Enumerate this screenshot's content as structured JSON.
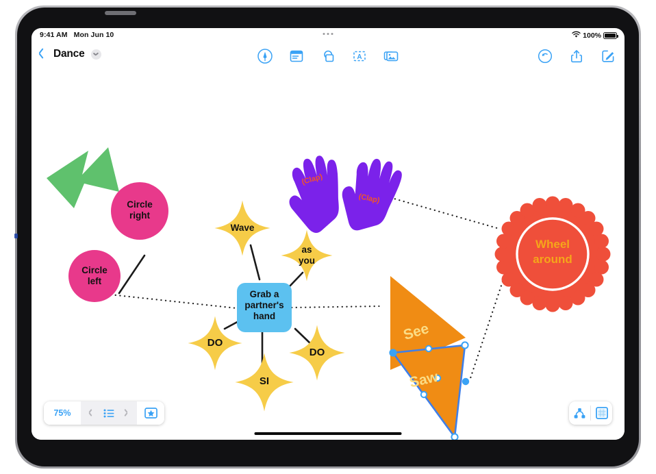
{
  "status_bar": {
    "time": "9:41 AM",
    "date": "Mon Jun 10",
    "wifi_icon": "wifi-icon",
    "battery_percent": "100%",
    "battery_icon": "battery-full-icon",
    "multitasking_icon": "multitasking-dots-icon"
  },
  "nav_bar": {
    "back_icon": "back-chevron-icon",
    "document_title": "Dance",
    "title_chevron_icon": "chevron-down-icon",
    "center_tools": [
      {
        "name": "draw-tool",
        "icon": "pen-circle-icon",
        "label": "Draw"
      },
      {
        "name": "sticky-note-tool",
        "icon": "sticky-note-icon",
        "label": "Sticky Note"
      },
      {
        "name": "shape-tool",
        "icon": "shapes-icon",
        "label": "Shapes"
      },
      {
        "name": "text-box-tool",
        "icon": "text-box-icon",
        "label": "Text Box"
      },
      {
        "name": "media-tool",
        "icon": "photos-icon",
        "label": "Media"
      }
    ],
    "right_tools": [
      {
        "name": "undo-button",
        "icon": "undo-arrow-icon",
        "label": "Undo"
      },
      {
        "name": "share-button",
        "icon": "share-up-arrow-icon",
        "label": "Share"
      },
      {
        "name": "compose-button",
        "icon": "compose-pencil-square-icon",
        "label": "Compose"
      }
    ]
  },
  "bottom_bar": {
    "zoom_level": "75%",
    "prev_icon": "chevron-left-icon",
    "page_list_icon": "list-bullet-icon",
    "next_icon": "chevron-right-icon",
    "star_icon": "star-in-rect-icon",
    "mindmap_icon": "node-graph-icon",
    "frame_icon": "frame-grid-icon"
  },
  "colors": {
    "accent_blue": "#3aa2f5",
    "pink": "#e8398b",
    "yellow_star": "#f6cc48",
    "node_blue": "#5cc1f0",
    "purple_hand": "#7b22ea",
    "clap_text": "#f2542a",
    "red_badge": "#ef4f3a",
    "wheel_text": "#f5a61a",
    "orange_triangle": "#f08c14",
    "triangle_text": "#fbdc85",
    "green_arrow": "#5cc濃"
  },
  "canvas": {
    "shapes": [
      {
        "id": "green-arrow",
        "name": "green-arrow-shape",
        "type": "arrow",
        "text": "",
        "fill": "#5fc16d"
      },
      {
        "id": "circle-right",
        "name": "circle-right-node",
        "type": "circle",
        "text": "Circle\nright",
        "fill": "#e8398b",
        "text_color": "#111111"
      },
      {
        "id": "circle-left",
        "name": "circle-left-node",
        "type": "circle",
        "text": "Circle\nleft",
        "fill": "#e8398b",
        "text_color": "#111111"
      },
      {
        "id": "hands",
        "name": "clapping-hands-shape",
        "type": "hands",
        "text": "(Clap)",
        "fill": "#7b22ea",
        "text_color": "#f2542a"
      },
      {
        "id": "star-wave",
        "name": "wave-star-node",
        "type": "four-point-star",
        "text": "Wave",
        "fill": "#f6cc48",
        "text_color": "#111111"
      },
      {
        "id": "star-asyou",
        "name": "as-you-star-node",
        "type": "four-point-star",
        "text": "as\nyou",
        "fill": "#f6cc48",
        "text_color": "#111111"
      },
      {
        "id": "center-node",
        "name": "grab-partner-node",
        "type": "rounded-rect",
        "text": "Grab a\npartner's\nhand",
        "fill": "#5cc1f0",
        "text_color": "#111111"
      },
      {
        "id": "star-do-left",
        "name": "do-left-star-node",
        "type": "four-point-star",
        "text": "DO",
        "fill": "#f6cc48",
        "text_color": "#111111"
      },
      {
        "id": "star-si",
        "name": "si-star-node",
        "type": "four-point-star",
        "text": "SI",
        "fill": "#f6cc48",
        "text_color": "#111111"
      },
      {
        "id": "star-do-right",
        "name": "do-right-star-node",
        "type": "four-point-star",
        "text": "DO",
        "fill": "#f6cc48",
        "text_color": "#111111"
      },
      {
        "id": "wheel-badge",
        "name": "wheel-around-badge",
        "type": "scalloped-circle",
        "text": "Wheel\naround",
        "fill": "#ef4f3a",
        "text_color": "#f5a61a"
      },
      {
        "id": "tri-see",
        "name": "see-triangle-shape",
        "type": "triangle",
        "text": "See",
        "fill": "#f08c14",
        "text_color": "#fbdc85"
      },
      {
        "id": "tri-saw",
        "name": "saw-triangle-shape",
        "type": "triangle",
        "text": "Saw",
        "fill": "#f08c14",
        "text_color": "#fbdc85",
        "selected": true
      }
    ],
    "selection": {
      "shape_id": "tri-saw",
      "handle_color": "#3aa2f5",
      "outline_color": "#3f7fe8"
    }
  },
  "labels": {
    "circle_right": "Circle\nright",
    "circle_left": "Circle\nleft",
    "clap_left": "(Clap)",
    "clap_right": "(Clap)",
    "wave": "Wave",
    "as_you": "as\nyou",
    "center": "Grab a\npartner's\nhand",
    "do_left": "DO",
    "si": "SI",
    "do_right": "DO",
    "wheel": "Wheel\naround",
    "see": "See",
    "saw": "Saw"
  }
}
